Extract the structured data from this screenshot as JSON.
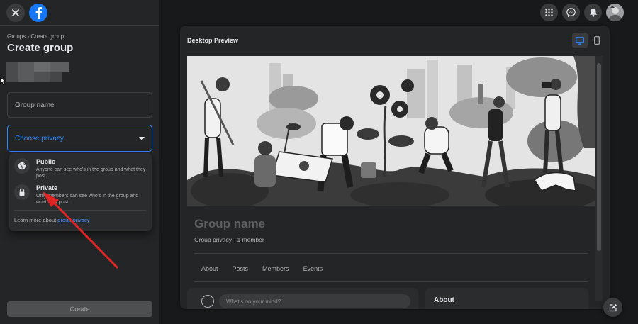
{
  "sidebar": {
    "breadcrumb": "Groups › Create group",
    "title": "Create group",
    "group_name_placeholder": "Group name",
    "privacy_placeholder": "Choose privacy",
    "privacy_options": [
      {
        "title": "Public",
        "description": "Anyone can see who's in the group and what they post.",
        "icon": "globe-icon"
      },
      {
        "title": "Private",
        "description": "Only members can see who's in the group and what they post.",
        "icon": "lock-icon"
      }
    ],
    "learn_more_prefix": "Learn more about ",
    "learn_more_link": "group privacy",
    "create_button": "Create"
  },
  "preview": {
    "title": "Desktop Preview",
    "group_name": "Group name",
    "meta": "Group privacy · 1 member",
    "tabs": [
      "About",
      "Posts",
      "Members",
      "Events"
    ],
    "composer_placeholder": "What's on your mind?",
    "about_heading": "About"
  },
  "colors": {
    "accent": "#2d88ff",
    "background": "#18191a",
    "surface": "#242526",
    "annotation_arrow": "#e02424"
  }
}
